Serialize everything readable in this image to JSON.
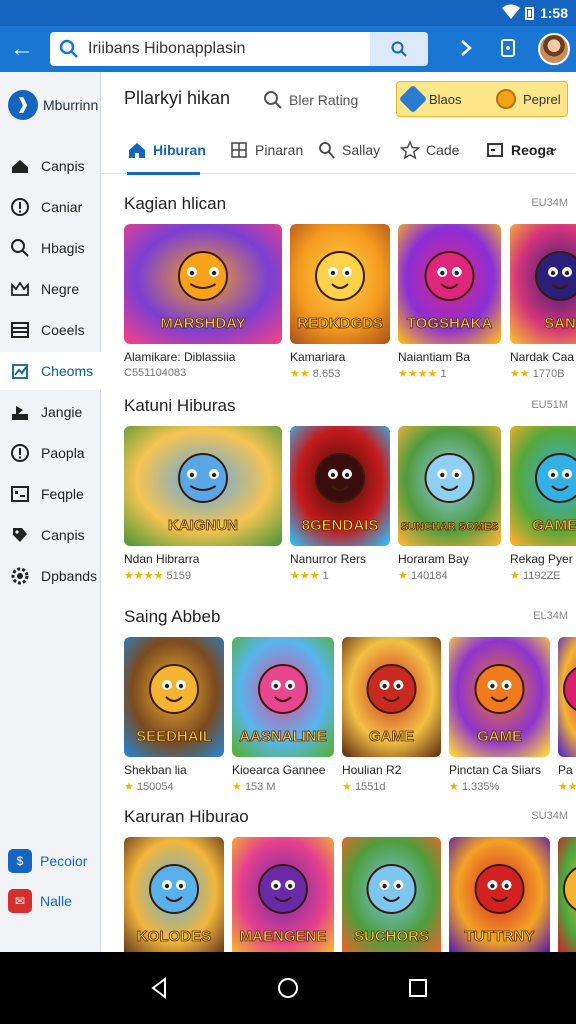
{
  "status_bar": {
    "time": "1:58"
  },
  "header": {
    "search_value": "Iriibans Hibonapplasin"
  },
  "sidebar": {
    "brand": "Mburrinn",
    "items": [
      {
        "label": "Canpis",
        "icon": "home-icon"
      },
      {
        "label": "Caniar",
        "icon": "info-icon"
      },
      {
        "label": "Hbagis",
        "icon": "search-icon"
      },
      {
        "label": "Negre",
        "icon": "crown-icon"
      },
      {
        "label": "Coeels",
        "icon": "list-icon"
      },
      {
        "label": "Cheoms",
        "icon": "chart-icon"
      },
      {
        "label": "Jangie",
        "icon": "user-icon"
      },
      {
        "label": "Paopla",
        "icon": "info-icon"
      },
      {
        "label": "Feqple",
        "icon": "image-icon"
      },
      {
        "label": "Canpis",
        "icon": "tag-icon"
      },
      {
        "label": "Dpbands",
        "icon": "gear-icon"
      }
    ],
    "active_index": 5,
    "bottom_items": [
      {
        "label": "Pecoior",
        "icon": "payment-icon",
        "color": "#1565c0"
      },
      {
        "label": "Nalle",
        "icon": "mail-icon",
        "color": "#d32f2f"
      }
    ]
  },
  "main": {
    "title": "Pllarkyi hikan",
    "rating_label": "Bler Rating",
    "coins": {
      "first": "Blaos",
      "second": "Peprel"
    },
    "tabs": [
      {
        "label": "Hiburan",
        "icon": "home-icon"
      },
      {
        "label": "Pinaran",
        "icon": "grid-icon"
      },
      {
        "label": "Sallay",
        "icon": "user-icon"
      },
      {
        "label": "Cade",
        "icon": "star-icon"
      },
      {
        "label": "Reoga",
        "icon": "dropdown-icon"
      }
    ],
    "active_tab": 0,
    "sections": [
      {
        "title": "Kagian hlican",
        "meta": "EU34M",
        "cards": [
          {
            "name": "Alamikare: Diblassiia",
            "meta": "C551104083",
            "stars": "",
            "art_text": "MARSHDAY",
            "palette": [
              "#f7a21b",
              "#7a3fd3",
              "#e8428c"
            ]
          },
          {
            "name": "Kamariara",
            "meta": "8.653",
            "stars": "★★",
            "art_text": "REDKDGDS",
            "palette": [
              "#fbd24a",
              "#f59a1f",
              "#b25a1d"
            ]
          },
          {
            "name": "Naiantiam Ba",
            "meta": "1",
            "stars": "★★★★",
            "art_text": "TOGSHAKA",
            "palette": [
              "#e0267a",
              "#8a2fd8",
              "#f7b324"
            ]
          },
          {
            "name": "Nardak Caa",
            "meta": "1770B",
            "stars": "★★",
            "art_text": "SAN",
            "palette": [
              "#2a1f7a",
              "#d3337a",
              "#f6b43a"
            ]
          }
        ]
      },
      {
        "title": "Katuni Hiburas",
        "meta": "EU51M",
        "cards": [
          {
            "name": "Ndan Hibrarra",
            "meta": "5159",
            "stars": "★★★★",
            "art_text": "KAIGNUN",
            "palette": [
              "#5aa7e8",
              "#f6c452",
              "#5d9b3a"
            ]
          },
          {
            "name": "Nanurror Rers",
            "meta": "1",
            "stars": "★★★",
            "art_text": "8GENDAIS",
            "palette": [
              "#3a0c0c",
              "#c41b1b",
              "#38b5ee"
            ]
          },
          {
            "name": "Horaram Bay",
            "meta": "140184",
            "stars": "★",
            "art_text": "SUNCHAR SOMES",
            "palette": [
              "#8ed0f4",
              "#4f9b3e",
              "#f3b23a"
            ]
          },
          {
            "name": "Rekag Pyer",
            "meta": "1192ZE",
            "stars": "★",
            "art_text": "GAMER",
            "palette": [
              "#33b0e6",
              "#55a73b",
              "#f6ad2a"
            ]
          }
        ]
      },
      {
        "title": "Saing Abbeb",
        "meta": "EL34M",
        "cards": [
          {
            "name": "Shekban lia",
            "meta": "150054",
            "stars": "★",
            "art_text": "SEEDHAIL",
            "palette": [
              "#f4b431",
              "#7b4a1f",
              "#2d7fc3"
            ]
          },
          {
            "name": "Kioearca Gannee",
            "meta": "153 M",
            "stars": "★",
            "art_text": "AASNALINE",
            "palette": [
              "#e94690",
              "#58b5ef",
              "#54b23d"
            ]
          },
          {
            "name": "Houlian R2",
            "meta": "1551d",
            "stars": "★",
            "art_text": "GAME",
            "palette": [
              "#c9291f",
              "#f3c145",
              "#6d3a16"
            ]
          },
          {
            "name": "Pinctan Ca Siiars",
            "meta": "1.335%",
            "stars": "★",
            "art_text": "GAME",
            "palette": [
              "#f07a1e",
              "#8e34cf",
              "#f9d13f"
            ]
          },
          {
            "name": "Pa",
            "meta": "",
            "stars": "★★★",
            "art_text": "",
            "palette": [
              "#d7206e",
              "#f4b530",
              "#5b2ac4"
            ]
          }
        ]
      },
      {
        "title": "Karuran Hiburao",
        "meta": "SU34M",
        "cards": [
          {
            "name": "",
            "meta": "",
            "stars": "",
            "art_text": "KOLODES",
            "palette": [
              "#58b1ea",
              "#f3b53a",
              "#6b3f1e"
            ]
          },
          {
            "name": "",
            "meta": "",
            "stars": "",
            "art_text": "MAENGENE",
            "palette": [
              "#6a2aa8",
              "#e5408d",
              "#f4b62f"
            ]
          },
          {
            "name": "",
            "meta": "",
            "stars": "",
            "art_text": "SUCHORS",
            "palette": [
              "#7cc6ef",
              "#4f9e3c",
              "#e7642a"
            ]
          },
          {
            "name": "",
            "meta": "",
            "stars": "",
            "art_text": "TUTTRNY",
            "palette": [
              "#d32020",
              "#f3a325",
              "#5a1fa6"
            ]
          },
          {
            "name": "",
            "meta": "",
            "stars": "",
            "art_text": "",
            "palette": [
              "#f6b231",
              "#4aa93e",
              "#c8242a"
            ]
          }
        ]
      }
    ]
  }
}
